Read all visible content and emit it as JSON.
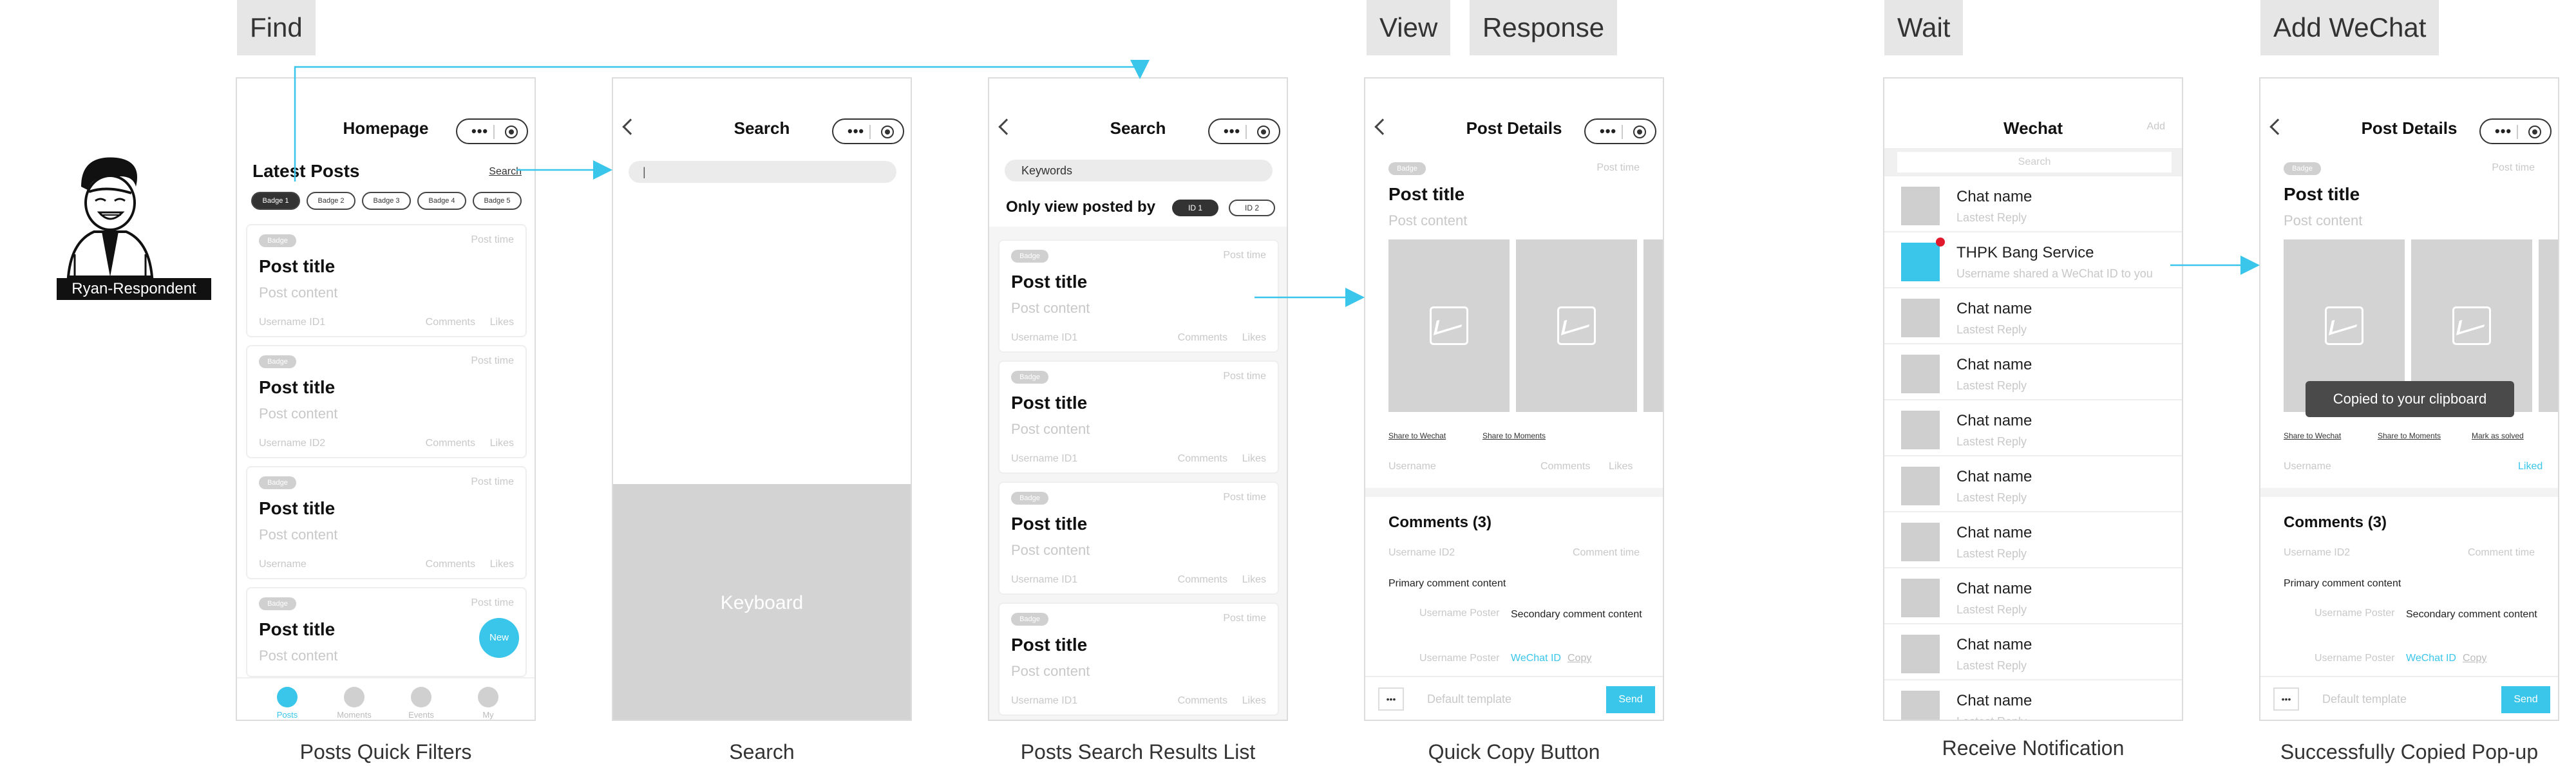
{
  "stages": {
    "find": "Find",
    "view": "View",
    "response": "Response",
    "wait": "Wait",
    "add_wechat": "Add WeChat"
  },
  "captions": {
    "c1": "Posts Quick Filters",
    "c2": "Search",
    "c3": "Posts Search Results List",
    "c4": "Quick Copy Button",
    "c5": "Receive Notification",
    "c6": "Successfully Copied Pop-up"
  },
  "persona": {
    "label": "Ryan-Respondent"
  },
  "home": {
    "title": "Homepage",
    "latest": "Latest Posts",
    "search_link": "Search",
    "badges": [
      "Badge 1",
      "Badge 2",
      "Badge 3",
      "Badge 4",
      "Badge 5"
    ],
    "posts": [
      {
        "badge": "Badge",
        "time": "Post time",
        "title": "Post title",
        "content": "Post content",
        "user": "Username ID1",
        "comments": "Comments",
        "likes": "Likes"
      },
      {
        "badge": "Badge",
        "time": "Post time",
        "title": "Post title",
        "content": "Post content",
        "user": "Username ID2",
        "comments": "Comments",
        "likes": "Likes"
      },
      {
        "badge": "Badge",
        "time": "Post time",
        "title": "Post title",
        "content": "Post content",
        "user": "Username",
        "comments": "Comments",
        "likes": "Likes"
      },
      {
        "badge": "Badge",
        "time": "Post time",
        "title": "Post title",
        "content": "Post content"
      }
    ],
    "new_button": "New",
    "tabs": [
      "Posts",
      "Moments",
      "Events",
      "My"
    ]
  },
  "search": {
    "title": "Search",
    "keyboard": "Keyboard",
    "cursor": "|"
  },
  "results": {
    "title": "Search",
    "keyword": "Keywords",
    "filter_label": "Only view posted by",
    "id1": "ID 1",
    "id2": "ID 2",
    "posts": [
      {
        "badge": "Badge",
        "time": "Post time",
        "title": "Post title",
        "content": "Post content",
        "user": "Username ID1",
        "comments": "Comments",
        "likes": "Likes"
      },
      {
        "badge": "Badge",
        "time": "Post time",
        "title": "Post title",
        "content": "Post content",
        "user": "Username ID1",
        "comments": "Comments",
        "likes": "Likes"
      },
      {
        "badge": "Badge",
        "time": "Post time",
        "title": "Post title",
        "content": "Post content",
        "user": "Username ID1",
        "comments": "Comments",
        "likes": "Likes"
      },
      {
        "badge": "Badge",
        "time": "Post time",
        "title": "Post title",
        "content": "Post content",
        "user": "Username ID1",
        "comments": "Comments",
        "likes": "Likes"
      }
    ]
  },
  "details": {
    "title": "Post Details",
    "badge": "Badge",
    "time": "Post time",
    "post_title": "Post title",
    "post_content": "Post content",
    "share_wechat": "Share to Wechat",
    "share_moments": "Share to Moments",
    "mark_solved": "Mark as solved",
    "username": "Username",
    "comments": "Comments",
    "likes": "Likes",
    "liked": "Liked",
    "comments_header": "Comments (3)",
    "c_user": "Username ID2",
    "c_time": "Comment time",
    "primary": "Primary comment content",
    "poster": "Username Poster",
    "secondary": "Secondary comment content",
    "wechat_id": "WeChat ID",
    "copy": "Copy",
    "more": "•••",
    "template": "Default template",
    "send": "Send",
    "toast": "Copied to your clipboard"
  },
  "wechat": {
    "title": "Wechat",
    "add": "Add",
    "search": "Search",
    "chat_name": "Chat name",
    "latest_reply": "Lastest Reply",
    "service_name": "THPK Bang Service",
    "service_msg": "Username shared a WeChat ID to you"
  },
  "colors": {
    "accent": "#39c6ea",
    "tag_bg": "#e6e6e6",
    "placeholder": "#d3d3d3"
  }
}
